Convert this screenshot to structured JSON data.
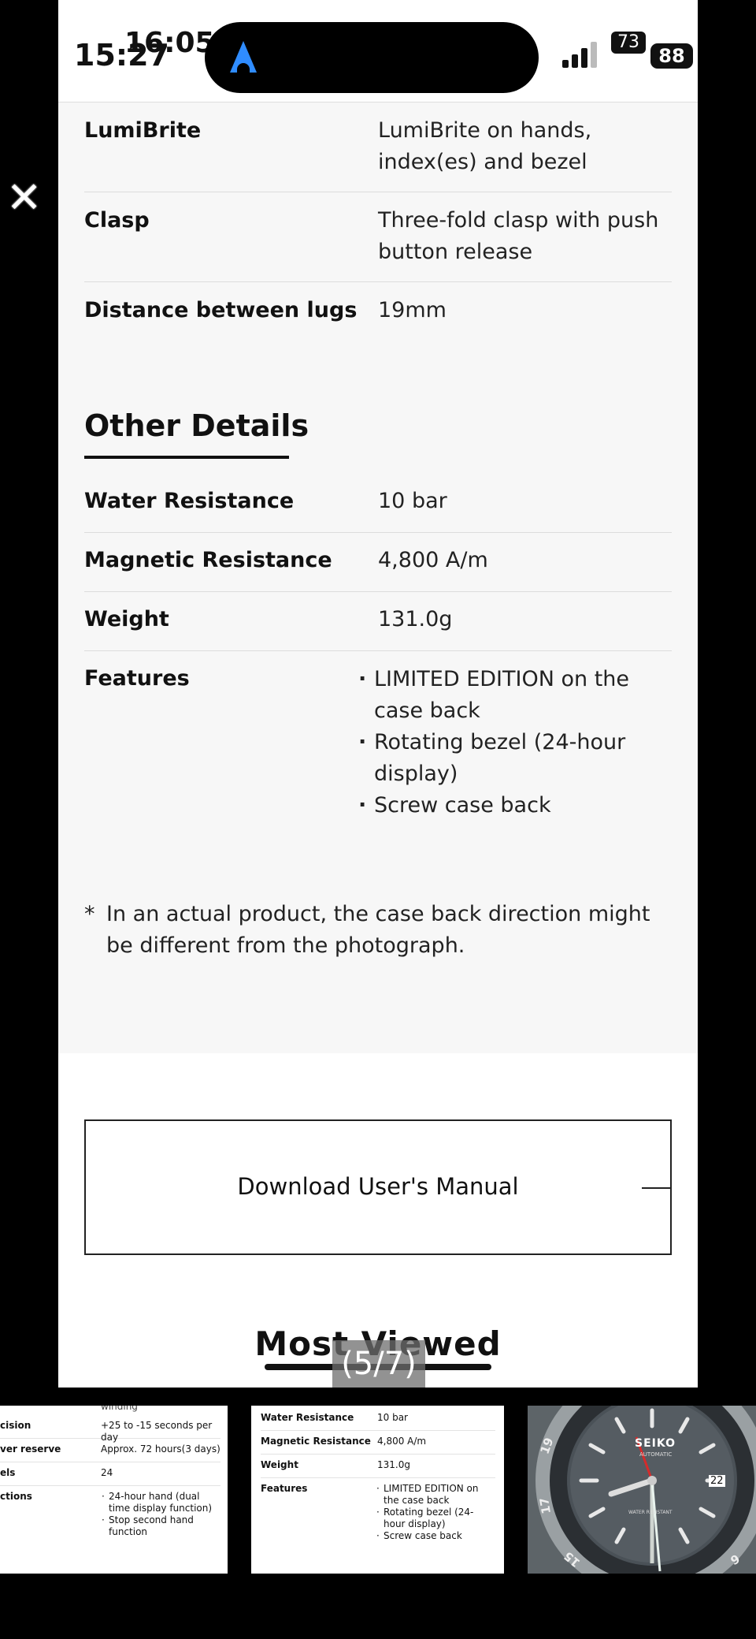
{
  "status_bar": {
    "time_primary": "15:27",
    "time_secondary": "16:05",
    "badge": "73",
    "battery": "88",
    "accent_color": "#2f8cff"
  },
  "close_icon": "close-icon",
  "specs_top": [
    {
      "label": "LumiBrite",
      "value": "LumiBrite on hands, index(es) and bezel"
    },
    {
      "label": "Clasp",
      "value": "Three-fold clasp with push button release"
    },
    {
      "label": "Distance between lugs",
      "value": "19mm"
    }
  ],
  "other_details": {
    "title": "Other Details",
    "rows": [
      {
        "label": "Water Resistance",
        "value": "10 bar"
      },
      {
        "label": "Magnetic Resistance",
        "value": "4,800 A/m"
      },
      {
        "label": "Weight",
        "value": "131.0g"
      }
    ],
    "features_label": "Features",
    "features": [
      "LIMITED EDITION on the case back",
      "Rotating bezel (24-hour display)",
      "Screw case back"
    ]
  },
  "note": {
    "star": "*",
    "text": "In an actual product, the case back direction might be different from the photograph."
  },
  "manual_button": {
    "label": "Download User's Manual"
  },
  "most_viewed": {
    "title": "Most Viewed"
  },
  "gallery_counter": "(5/7)",
  "thumb1": {
    "top_fragment": "winding",
    "rows": [
      {
        "label": "cision",
        "value": "+25 to -15 seconds per day"
      },
      {
        "label": "ver reserve",
        "value": "Approx. 72 hours(3 days)"
      },
      {
        "label": "els",
        "value": "24"
      }
    ],
    "functions_label": "ctions",
    "functions": [
      "24-hour hand (dual time display function)",
      "Stop second hand function"
    ]
  },
  "thumb2": {
    "rows": [
      {
        "label": "Water Resistance",
        "value": "10 bar"
      },
      {
        "label": "Magnetic Resistance",
        "value": "4,800 A/m"
      },
      {
        "label": "Weight",
        "value": "131.0g"
      }
    ],
    "features_label": "Features",
    "features": [
      "LIMITED EDITION on the case back",
      "Rotating bezel (24-hour display)",
      "Screw case back"
    ]
  },
  "thumb3": {
    "brand": "SEIKO",
    "sub": "AUTOMATIC",
    "date": "22",
    "wr_text": "WATER RESISTANT",
    "bezel_numbers": [
      "19",
      "17",
      "15",
      "6"
    ]
  }
}
